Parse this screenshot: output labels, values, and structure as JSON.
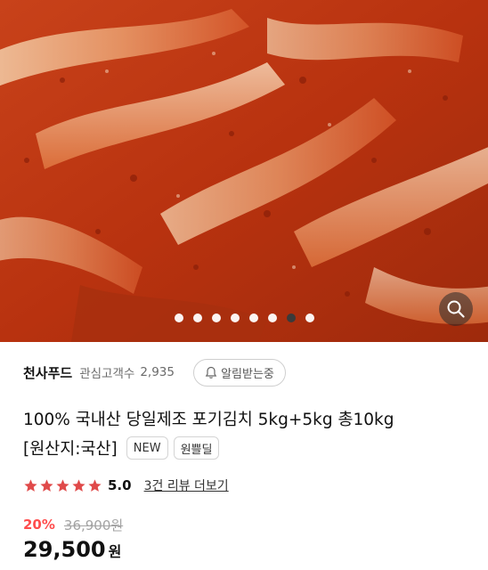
{
  "hero": {
    "image_alt": "kimchi product photo",
    "total_slides": 8,
    "active_slide": 7,
    "zoom_icon": "search-icon"
  },
  "seller": {
    "name": "천사푸드",
    "fav_label": "관심고객수",
    "fav_count": "2,935",
    "alert_icon": "bell-icon",
    "alert_label": "알림받는중"
  },
  "product": {
    "title_line1": "100% 국내산 당일제조 포기김치 5kg+5kg 총10kg",
    "title_line2": "[원산지:국산]",
    "tags": [
      "NEW",
      "원쁠딜"
    ]
  },
  "rating": {
    "stars": 5,
    "score": "5.0",
    "reviews_link": "3건 리뷰 더보기",
    "star_color": "#e04a4a"
  },
  "price": {
    "discount": "20%",
    "original": "36,900원",
    "sale": "29,500",
    "currency": "원",
    "discount_color": "#ff4d4d"
  }
}
